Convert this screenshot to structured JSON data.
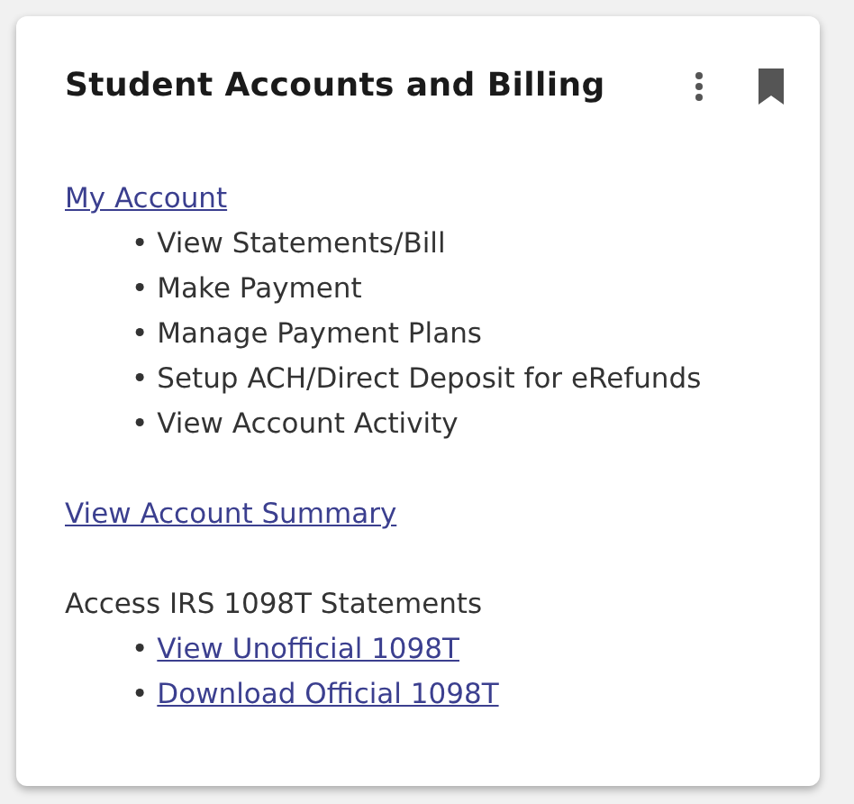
{
  "card": {
    "title": "Student Accounts and Billing",
    "sections": [
      {
        "heading": {
          "kind": "link",
          "text": "My Account"
        },
        "items": [
          {
            "bullet": "•",
            "kind": "text",
            "text": "View Statements/Bill"
          },
          {
            "bullet": "•",
            "kind": "text",
            "text": "Make Payment"
          },
          {
            "bullet": "•",
            "kind": "text",
            "text": "Manage Payment Plans"
          },
          {
            "bullet": "•",
            "kind": "text",
            "text": "Setup ACH/Direct Deposit for eRefunds"
          },
          {
            "bullet": "•",
            "kind": "text",
            "text": "View Account Activity"
          }
        ]
      },
      {
        "heading": {
          "kind": "link",
          "text": "View Account Summary"
        }
      },
      {
        "heading": {
          "kind": "text",
          "text": "Access IRS 1098T Statements"
        },
        "items": [
          {
            "bullet": "•",
            "kind": "link",
            "text": "View Unofficial 1098T"
          },
          {
            "bullet": "•",
            "kind": "link",
            "text": "Download Official 1098T"
          }
        ]
      }
    ]
  }
}
